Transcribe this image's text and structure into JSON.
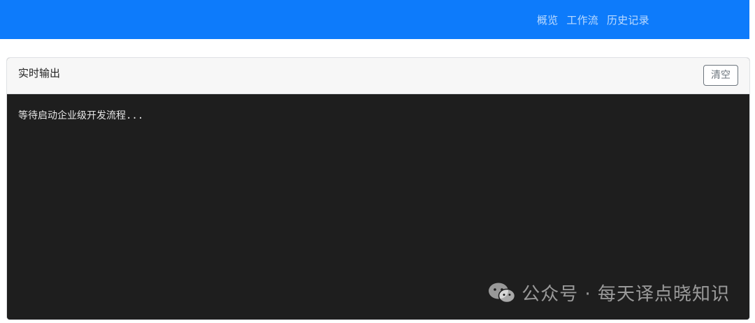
{
  "navbar": {
    "links": [
      "概览",
      "工作流",
      "历史记录"
    ],
    "brand_color": "#0d7bfb"
  },
  "output_panel": {
    "title": "实时输出",
    "clear_label": "清空",
    "log_text": "等待启动企业级开发流程...",
    "background_color": "#1e1e1e"
  },
  "watermark": {
    "icon": "wechat-icon",
    "text": "公众号 · 每天译点晓知识"
  }
}
